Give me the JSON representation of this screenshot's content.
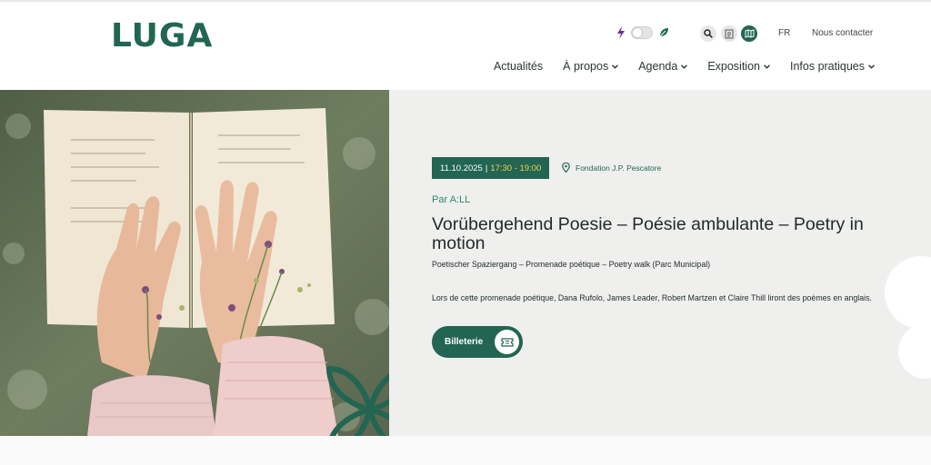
{
  "header": {
    "logo": "LUGA",
    "lang": "FR",
    "contact": "Nous contacter",
    "nav": [
      {
        "label": "Actualités",
        "caret": false
      },
      {
        "label": "À propos",
        "caret": true
      },
      {
        "label": "Agenda",
        "caret": true
      },
      {
        "label": "Exposition",
        "caret": true
      },
      {
        "label": "Infos pratiques",
        "caret": true
      }
    ]
  },
  "event": {
    "date": "11.10.2025",
    "separator": "|",
    "time": "17:30 - 19:00",
    "location": "Fondation J.P. Pescatore",
    "organizer": "Par A:LL",
    "title": "Vorübergehend Poesie – Poésie ambulante – Poetry in motion",
    "subtitle": "Poetischer Spaziergang – Promenade poétique – Poetry walk (Parc Municipal)",
    "description": "Lors de cette promenade poétique, Dana Rufolo, James Leader, Robert Martzen et Claire Thill liront des poèmes en anglais.",
    "ticket_label": "Billeterie"
  },
  "colors": {
    "brand": "#226552",
    "accent": "#f0d24a",
    "bolt": "#6b2fa0"
  },
  "icons": [
    "bolt-icon",
    "leaf-icon",
    "search-icon",
    "document-icon",
    "map-icon",
    "location-pin-icon",
    "ticket-icon",
    "chevron-down-icon"
  ]
}
